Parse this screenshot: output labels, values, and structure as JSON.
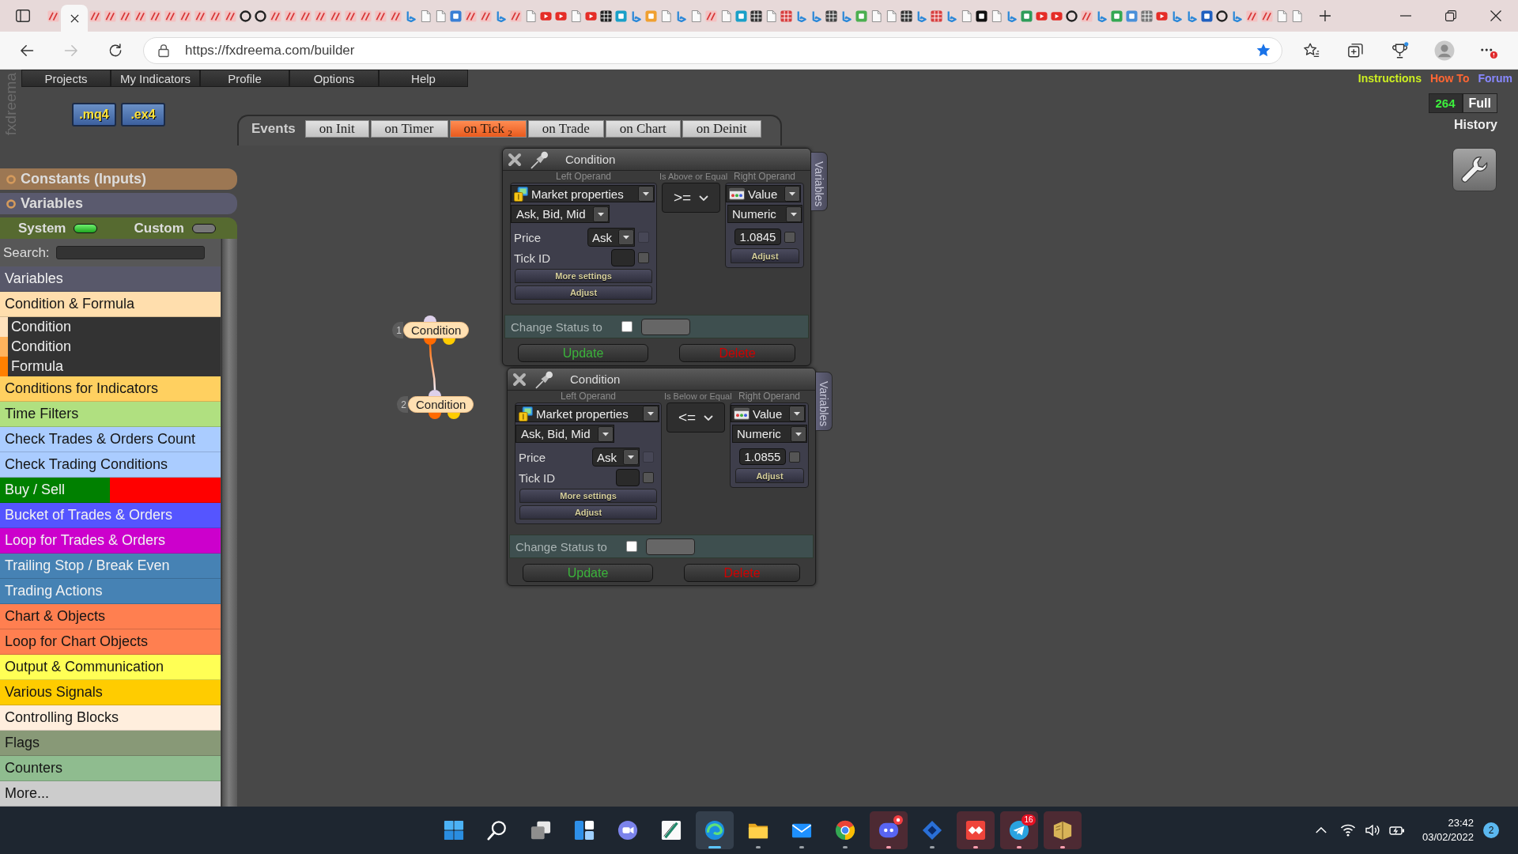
{
  "browser": {
    "tabs": [
      {
        "kind": "striped",
        "selected": false
      },
      {
        "selected": true
      },
      {
        "kind": "striped",
        "selected": false
      },
      {
        "kind": "striped",
        "selected": false
      },
      {
        "kind": "striped",
        "selected": false
      },
      {
        "kind": "striped",
        "selected": false
      },
      {
        "kind": "striped",
        "selected": false
      },
      {
        "kind": "striped",
        "selected": false
      },
      {
        "kind": "striped",
        "selected": false
      },
      {
        "kind": "striped",
        "selected": false
      },
      {
        "kind": "striped",
        "selected": false
      },
      {
        "kind": "striped",
        "selected": false
      },
      {
        "kind": "ring",
        "selected": false
      },
      {
        "kind": "ring",
        "selected": false
      },
      {
        "kind": "striped",
        "selected": false
      },
      {
        "kind": "striped",
        "selected": false
      },
      {
        "kind": "striped",
        "selected": false
      },
      {
        "kind": "striped",
        "selected": false
      },
      {
        "kind": "striped",
        "selected": false
      },
      {
        "kind": "striped",
        "selected": false
      },
      {
        "kind": "striped",
        "selected": false
      },
      {
        "kind": "striped",
        "selected": false
      },
      {
        "kind": "striped",
        "selected": false
      },
      {
        "kind": "swoosh",
        "selected": false
      },
      {
        "kind": "page",
        "selected": false
      },
      {
        "kind": "page",
        "selected": false
      },
      {
        "kind": "tile",
        "color": "#3a7fd5",
        "selected": false
      },
      {
        "kind": "striped",
        "selected": false
      },
      {
        "kind": "striped",
        "selected": false
      },
      {
        "kind": "swoosh",
        "selected": false
      },
      {
        "kind": "striped",
        "selected": false
      },
      {
        "kind": "page",
        "selected": false
      },
      {
        "kind": "play",
        "selected": false
      },
      {
        "kind": "play",
        "selected": false
      },
      {
        "kind": "page",
        "selected": false
      },
      {
        "kind": "play",
        "selected": false
      },
      {
        "kind": "grid",
        "color": "#222222",
        "selected": false
      },
      {
        "kind": "tile",
        "color": "#1aa0c8",
        "selected": false
      },
      {
        "kind": "swoosh",
        "selected": false
      },
      {
        "kind": "tile",
        "color": "#f0a030",
        "selected": false
      },
      {
        "kind": "page",
        "selected": false
      },
      {
        "kind": "swoosh",
        "selected": false
      },
      {
        "kind": "page",
        "selected": false
      },
      {
        "kind": "striped",
        "selected": false
      },
      {
        "kind": "page",
        "selected": false
      },
      {
        "kind": "tile",
        "color": "#1aa0c8",
        "selected": false
      },
      {
        "kind": "grid",
        "color": "#333333",
        "selected": false
      },
      {
        "kind": "page",
        "selected": false
      },
      {
        "kind": "grid",
        "color": "#d84040",
        "selected": false
      },
      {
        "kind": "swoosh",
        "selected": false
      },
      {
        "kind": "swoosh",
        "selected": false
      },
      {
        "kind": "grid",
        "color": "#444444",
        "selected": false
      },
      {
        "kind": "swoosh",
        "selected": false
      },
      {
        "kind": "tile",
        "color": "#4caf50",
        "selected": false
      },
      {
        "kind": "page",
        "selected": false
      },
      {
        "kind": "page",
        "selected": false
      },
      {
        "kind": "grid",
        "color": "#333333",
        "selected": false
      },
      {
        "kind": "swoosh",
        "selected": false
      },
      {
        "kind": "grid",
        "color": "#d84040",
        "selected": false
      },
      {
        "kind": "swoosh",
        "selected": false
      },
      {
        "kind": "page",
        "selected": false
      },
      {
        "kind": "tile",
        "color": "#111111",
        "selected": false
      },
      {
        "kind": "page",
        "selected": false
      },
      {
        "kind": "swoosh",
        "selected": false
      },
      {
        "kind": "tile",
        "color": "#2e9d5a",
        "selected": false
      },
      {
        "kind": "play",
        "selected": false
      },
      {
        "kind": "play",
        "selected": false
      },
      {
        "kind": "ring",
        "selected": false
      },
      {
        "kind": "striped",
        "selected": false
      },
      {
        "kind": "swoosh",
        "selected": false
      },
      {
        "kind": "tile",
        "color": "#34a853",
        "selected": false
      },
      {
        "kind": "tile",
        "color": "#4a90d9",
        "selected": false
      },
      {
        "kind": "grid",
        "color": "#777777",
        "selected": false
      },
      {
        "kind": "play",
        "selected": false
      },
      {
        "kind": "swoosh",
        "selected": false
      },
      {
        "kind": "swoosh",
        "selected": false
      },
      {
        "kind": "tile",
        "color": "#2060c0",
        "selected": false
      },
      {
        "kind": "ring",
        "selected": false
      },
      {
        "kind": "swoosh",
        "selected": false
      },
      {
        "kind": "striped",
        "selected": false
      },
      {
        "kind": "striped",
        "selected": false
      },
      {
        "kind": "page",
        "selected": false
      },
      {
        "kind": "page",
        "selected": false
      }
    ],
    "address": "https://fxdreema.com/builder",
    "can_go_forward": false,
    "bookmarked": true
  },
  "app": {
    "logo": "fxdreema",
    "menu": [
      "Projects",
      "My Indicators",
      "Profile",
      "Options",
      "Help"
    ],
    "links": [
      {
        "label": "Instructions",
        "color": "#ccee22"
      },
      {
        "label": "How To",
        "color": "#ff6633"
      },
      {
        "label": "Forum",
        "color": "#8888ff"
      }
    ],
    "file_buttons": [
      ".mq4",
      ".ex4"
    ],
    "events": {
      "label": "Events",
      "tabs": [
        {
          "label": "on Init",
          "selected": false
        },
        {
          "label": "on Timer",
          "selected": false
        },
        {
          "label": "on Tick $_{2}$",
          "selected": true
        },
        {
          "label": "on Trade",
          "selected": false
        },
        {
          "label": "on Chart",
          "selected": false
        },
        {
          "label": "on Deinit",
          "selected": false
        }
      ]
    },
    "counter": {
      "value": "264",
      "label": "Full"
    },
    "history": "History"
  },
  "sidebar": {
    "sections": [
      {
        "label": "Constants (Inputs)",
        "color": "#9c7753"
      },
      {
        "label": "Variables",
        "color": "#5a5a6e"
      }
    ],
    "toggles": [
      {
        "label": "System",
        "on": true
      },
      {
        "label": "Custom",
        "on": false
      }
    ],
    "search": {
      "label": "Search:"
    },
    "categories": [
      {
        "label": "Variables",
        "color": "#58586a"
      },
      {
        "label": "Condition & Formula",
        "color": "#ffdead",
        "expanded": true,
        "children": [
          {
            "label": "Condition",
            "color": "#ffe2bd"
          },
          {
            "label": "Condition",
            "color": "#ffb35c"
          },
          {
            "label": "Formula",
            "color": "#ff8000"
          }
        ]
      },
      {
        "label": "Conditions for Indicators",
        "color": "#ffd060"
      },
      {
        "label": "Time Filters",
        "color": "#b0e080"
      },
      {
        "label": "Check Trades & Orders Count",
        "color": "#aaccff"
      },
      {
        "label": "Check Trading Conditions",
        "color": "#aaccff"
      },
      {
        "label": "Buy / Sell",
        "halves": [
          {
            "color": "#008000"
          },
          {
            "color": "#ff0000"
          }
        ]
      },
      {
        "label": "Bucket of Trades & Orders",
        "color": "#5555ff"
      },
      {
        "label": "Loop for Trades & Orders",
        "color": "#cc00cc"
      },
      {
        "label": "Trailing Stop / Break Even",
        "color": "#4682b4"
      },
      {
        "label": "Trading Actions",
        "color": "#4682b4"
      },
      {
        "label": "Chart & Objects",
        "color": "#ff7f50"
      },
      {
        "label": "Loop for Chart Objects",
        "color": "#ff7f50"
      },
      {
        "label": "Output & Communication",
        "color": "#ffff55"
      },
      {
        "label": "Various Signals",
        "color": "#ffcc00"
      },
      {
        "label": "Controlling Blocks",
        "color": "#ffeedd"
      },
      {
        "label": "Flags",
        "color": "#889977"
      },
      {
        "label": "Counters",
        "color": "#8fbc8f"
      },
      {
        "label": "More...",
        "color": "#cccccc"
      }
    ]
  },
  "canvas": {
    "blocks": [
      {
        "number": "1",
        "label": "Condition",
        "linked_to_next": true
      },
      {
        "number": "2",
        "label": "Condition",
        "linked_to_next": false
      }
    ],
    "panels": [
      {
        "title": "Condition",
        "side_tab": "Variables",
        "left_label": "Left Operand",
        "operator_label": "Is Above or Equal",
        "right_label": "Right Operand",
        "left": {
          "source": "Market properties",
          "group": "Ask, Bid, Mid",
          "fields": [
            {
              "kind": "select",
              "label": "Price",
              "value": "Ask",
              "checked": false,
              "disabled": true
            },
            {
              "kind": "input",
              "label": "Tick ID",
              "checked": false,
              "disabled": false
            }
          ],
          "buttons": [
            "More settings",
            "Adjust"
          ]
        },
        "operator": ">=",
        "right": {
          "source": "Value",
          "type": "Numeric",
          "value": "1.0845",
          "checked": false,
          "button": "Adjust"
        },
        "status": {
          "label": "Change Status to",
          "checked": false
        },
        "actions": [
          {
            "kind": "update",
            "label": "Update"
          },
          {
            "kind": "delete",
            "label": "Delete"
          }
        ]
      },
      {
        "title": "Condition",
        "side_tab": "Variables",
        "left_label": "Left Operand",
        "operator_label": "Is Below or Equal",
        "right_label": "Right Operand",
        "left": {
          "source": "Market properties",
          "group": "Ask, Bid, Mid",
          "fields": [
            {
              "kind": "select",
              "label": "Price",
              "value": "Ask",
              "checked": false,
              "disabled": true
            },
            {
              "kind": "input",
              "label": "Tick ID",
              "checked": false,
              "disabled": false
            }
          ],
          "buttons": [
            "More settings",
            "Adjust"
          ]
        },
        "operator": "<=",
        "right": {
          "source": "Value",
          "type": "Numeric",
          "value": "1.0855",
          "checked": false,
          "button": "Adjust"
        },
        "status": {
          "label": "Change Status to",
          "checked": false
        },
        "actions": [
          {
            "kind": "update",
            "label": "Update"
          },
          {
            "kind": "delete",
            "label": "Delete"
          }
        ]
      }
    ]
  },
  "taskbar": {
    "apps": [
      {
        "kind": "start",
        "running": false,
        "selected": false,
        "attention": false
      },
      {
        "kind": "search",
        "running": false,
        "selected": false,
        "attention": false
      },
      {
        "kind": "taskview",
        "running": false,
        "selected": false,
        "attention": false
      },
      {
        "kind": "widgets",
        "running": false,
        "selected": false,
        "attention": false
      },
      {
        "kind": "chat",
        "running": false,
        "selected": false,
        "attention": false
      },
      {
        "kind": "slash",
        "running": false,
        "selected": false,
        "attention": false
      },
      {
        "kind": "swirl",
        "running": true,
        "selected": true,
        "attention": false
      },
      {
        "kind": "folder",
        "running": true,
        "selected": false,
        "attention": false
      },
      {
        "kind": "mail",
        "running": true,
        "selected": false,
        "attention": false
      },
      {
        "kind": "circle",
        "running": true,
        "selected": false,
        "attention": false
      },
      {
        "kind": "controller",
        "running": true,
        "selected": false,
        "attention": true,
        "alert": true
      },
      {
        "kind": "diamond",
        "running": true,
        "selected": false,
        "attention": false
      },
      {
        "kind": "diamond_tile",
        "running": true,
        "selected": false,
        "attention": true
      },
      {
        "kind": "plane",
        "running": true,
        "selected": false,
        "attention": true,
        "badge": "16"
      },
      {
        "kind": "book",
        "running": true,
        "selected": false,
        "attention": true
      }
    ],
    "tray": {
      "time": "23:42",
      "date": "03/02/2022",
      "notifications": "2"
    }
  }
}
